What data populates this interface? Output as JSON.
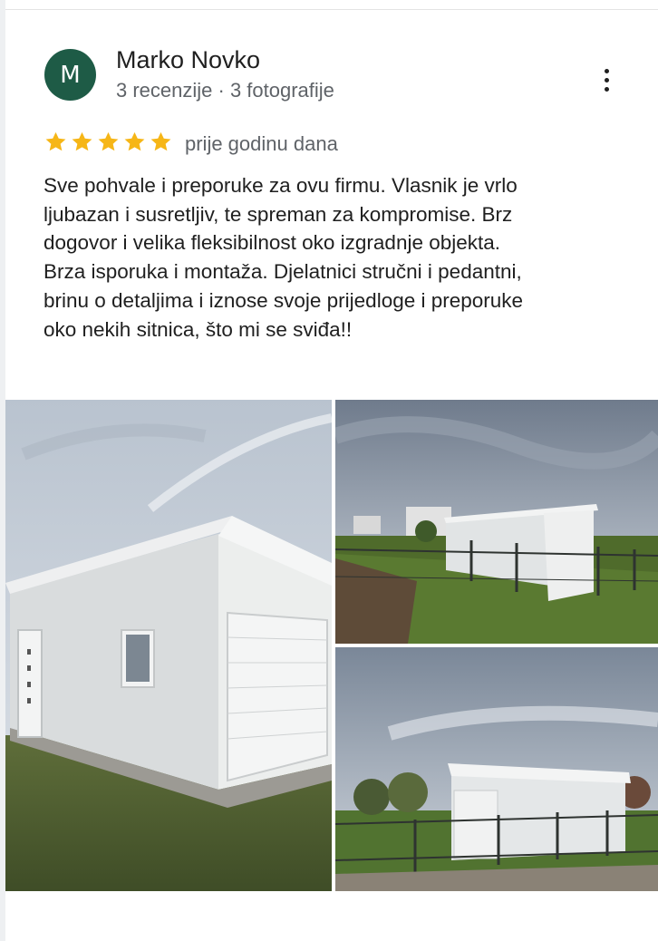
{
  "reviewer": {
    "initial": "M",
    "name": "Marko Novko",
    "meta": "3 recenzije · 3 fotografije",
    "avatar_color": "#1e5b46"
  },
  "rating": {
    "stars": 5,
    "max": 5,
    "star_color": "#f6b617",
    "time": "prije godinu dana"
  },
  "review_lines": [
    "Sve pohvale i preporuke za ovu firmu. Vlasnik je vrlo",
    "ljubazan i susretljiv, te spreman za kompromise. Brz",
    "dogovor i velika fleksibilnost oko izgradnje objekta.",
    "Brza isporuka i montaža. Djelatnici stručni i pedantni,",
    "brinu o detaljima i iznose svoje prijedloge i preporuke",
    "oko nekih sitnica, što mi se sviđa!!"
  ],
  "menu_icon": "more-vertical-icon",
  "photos": [
    "photo-garage-closeup",
    "photo-garage-yard",
    "photo-garage-fence"
  ]
}
